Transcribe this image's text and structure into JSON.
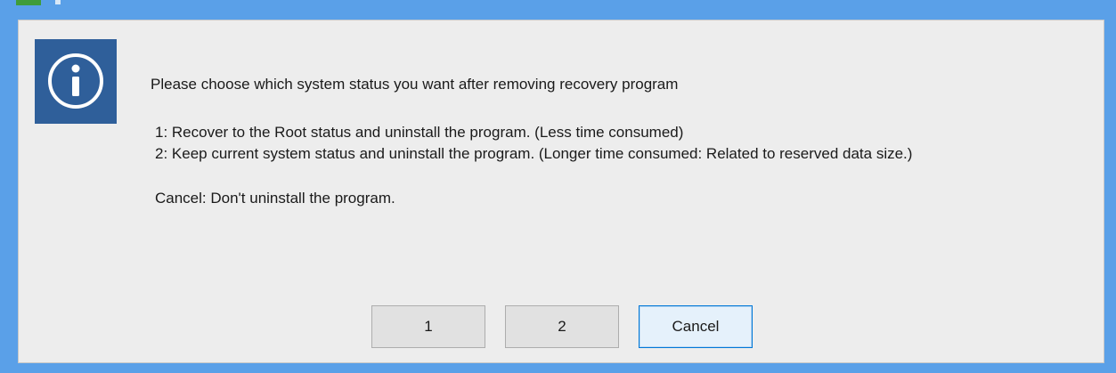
{
  "dialog": {
    "lines": {
      "prompt": "Please choose which system status you want after removing recovery program",
      "option1": "1: Recover to the Root status and uninstall the program. (Less time consumed)",
      "option2": "2: Keep current system status and uninstall the program. (Longer time consumed: Related to reserved data size.)",
      "cancel_note": "Cancel: Don't uninstall the program."
    },
    "icon": "info-icon",
    "buttons": {
      "one": "1",
      "two": "2",
      "cancel": "Cancel"
    }
  },
  "colors": {
    "frame": "#5aa0e8",
    "info_box": "#2f5f9a",
    "client_bg": "#ededed",
    "default_button_border": "#0078d7"
  }
}
